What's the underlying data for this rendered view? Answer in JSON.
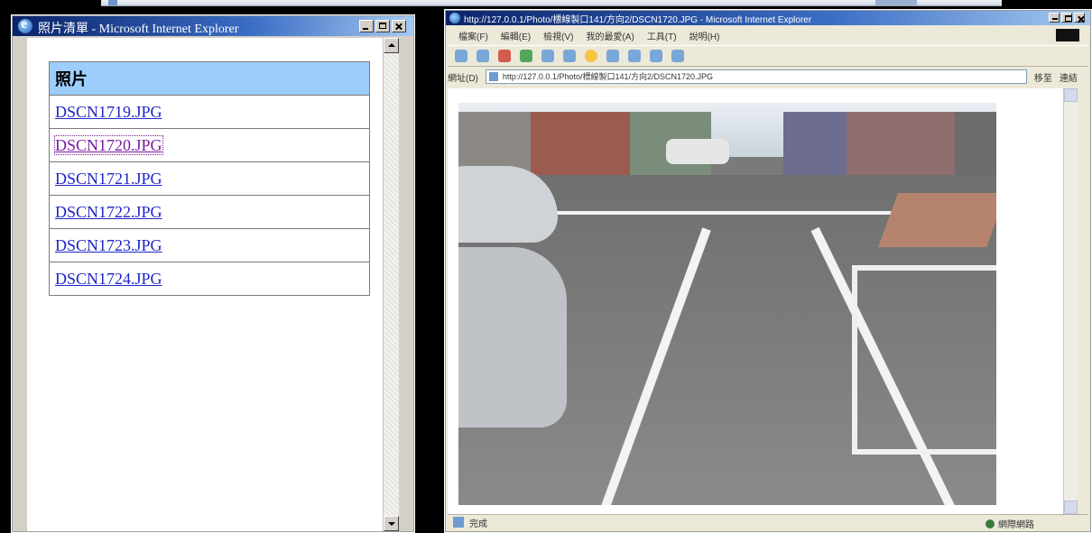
{
  "left_window": {
    "title": "照片清單 - Microsoft Internet Explorer",
    "table_header": "照片",
    "photos": [
      {
        "name": "DSCN1719.JPG",
        "visited": false
      },
      {
        "name": "DSCN1720.JPG",
        "visited": true
      },
      {
        "name": "DSCN1721.JPG",
        "visited": false
      },
      {
        "name": "DSCN1722.JPG",
        "visited": false
      },
      {
        "name": "DSCN1723.JPG",
        "visited": false
      },
      {
        "name": "DSCN1724.JPG",
        "visited": false
      }
    ]
  },
  "right_window": {
    "title": "http://127.0.0.1/Photo/標線製口141/方向2/DSCN1720.JPG - Microsoft Internet Explorer",
    "menu": [
      "檔案(F)",
      "編輯(E)",
      "檢視(V)",
      "我的最愛(A)",
      "工具(T)",
      "說明(H)"
    ],
    "address_label": "網址(D)",
    "address_value": "http://127.0.0.1/Photo/標線製口141/方向2/DSCN1720.JPG",
    "go_label": "移至",
    "links_label": "連結",
    "status_text": "完成",
    "zone_text": "網際網路"
  },
  "colors": {
    "title_gradient_start": "#0a246a",
    "title_gradient_end": "#a6caf0",
    "table_header_bg": "#9dcdfb",
    "link_color": "#1f25c8",
    "visited_color": "#7a1aa0"
  },
  "icons": {
    "left_title_icon": "ie-icon",
    "right_title_icon": "ie-icon",
    "status_icon": "globe-icon",
    "zone_icon": "internet-zone-icon"
  }
}
